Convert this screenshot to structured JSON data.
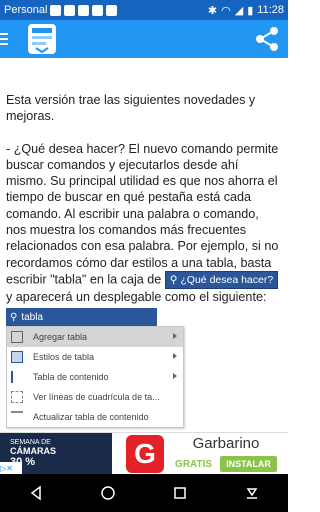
{
  "status": {
    "carrier": "Personal",
    "time": "11:28"
  },
  "content": {
    "intro": "Esta versión  trae las siguientes novedades y mejoras.",
    "paragraph_a": "- ¿Qué desea hacer? El nuevo comando  permite buscar comandos y ejecutarlos desde ahí mismo. Su principal utilidad es que nos ahorra el tiempo de buscar en qué pestaña está cada comando. Al escribir una palabra o comando, nos muestra los comandos más frecuentes relacionados con esa palabra. Por ejemplo, si no recordamos cómo dar estilos a una tabla, basta escribir \"tabla\" en la caja de",
    "inline_box": "¿Qué desea hacer?",
    "paragraph_b": " y aparecerá un desplegable como el siguiente:"
  },
  "example": {
    "search_value": "tabla",
    "items": [
      {
        "label": "Agregar tabla",
        "arrow": true,
        "highlight": true
      },
      {
        "label": "Estilos de tabla",
        "arrow": true,
        "highlight": false
      },
      {
        "label": "Tabla de contenido",
        "arrow": true,
        "highlight": false
      },
      {
        "label": "Ver líneas de cuadrícula de ta...",
        "arrow": false,
        "highlight": false
      },
      {
        "label": "Actualizar tabla de contenido",
        "arrow": false,
        "highlight": false
      }
    ]
  },
  "ad": {
    "left_line1": "SEMANA DE",
    "left_line2": "CÁMARAS",
    "left_line3": "30 %",
    "logo_letter": "G",
    "title": "Garbarino",
    "gratis": "GRATIS",
    "install": "INSTALAR"
  },
  "colors": {
    "status_bar": "#1565c0",
    "app_bar": "#2196f3",
    "office_blue": "#2b579a",
    "ad_red": "#e32227",
    "ad_green": "#8bc34a"
  }
}
